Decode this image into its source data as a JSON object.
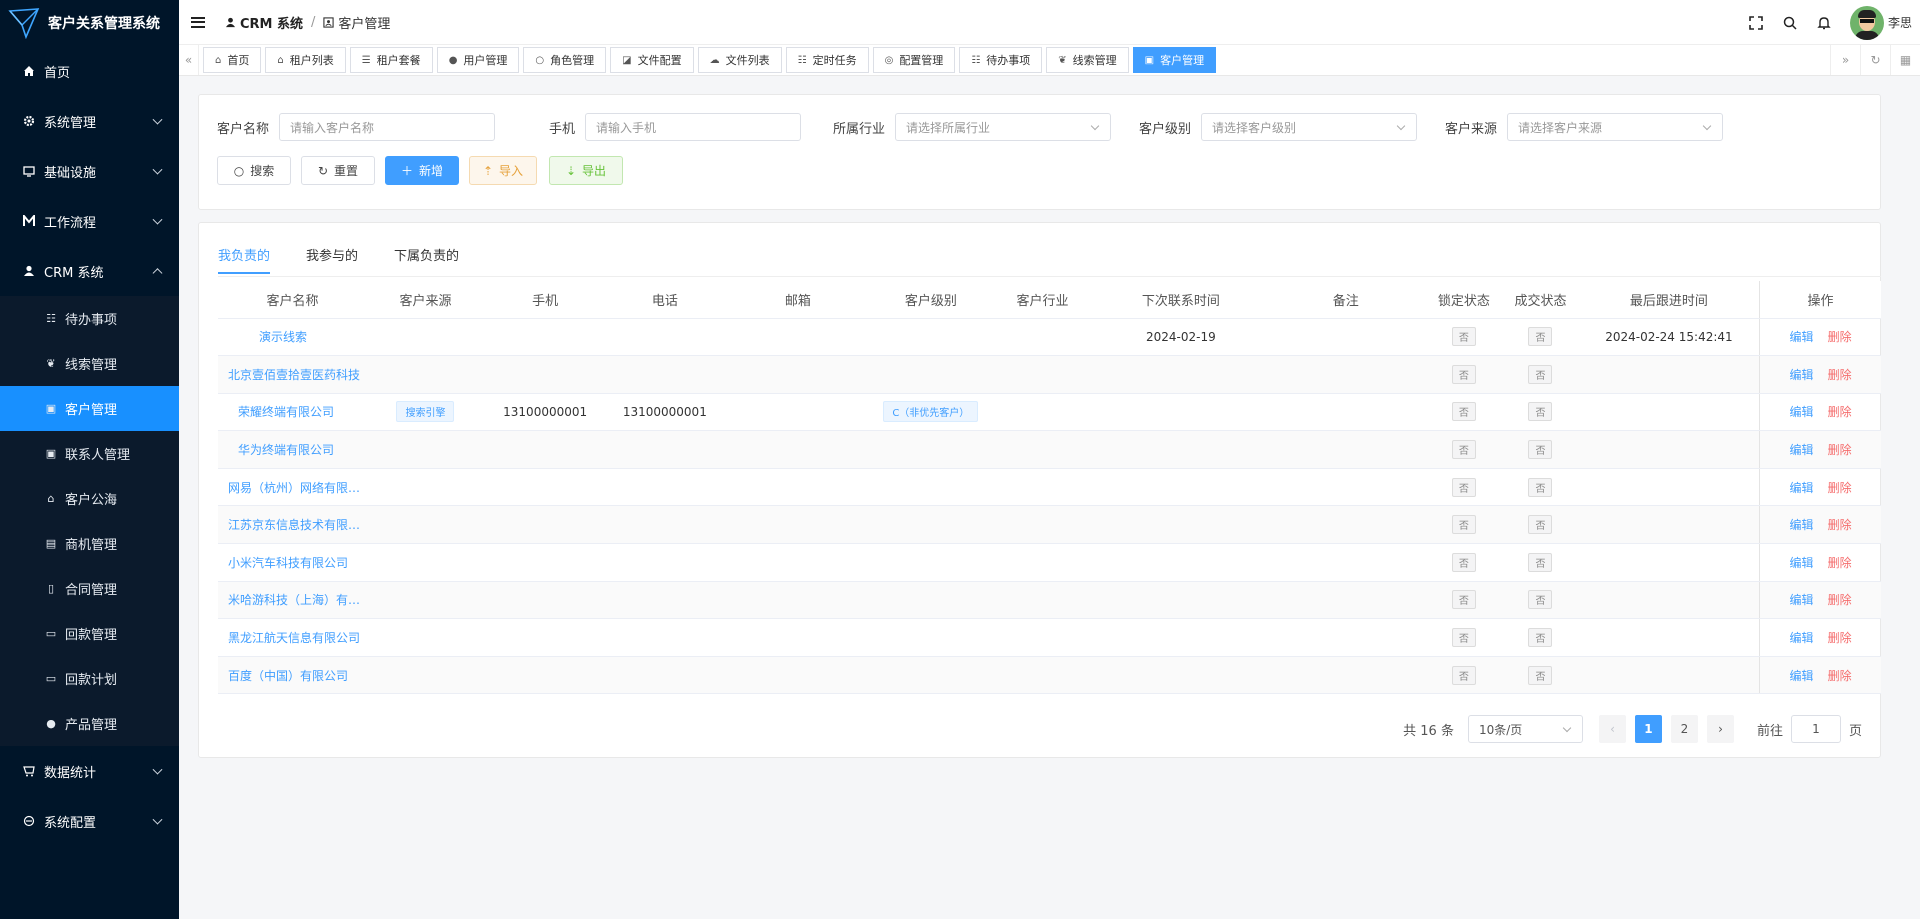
{
  "app": {
    "title": "客户关系管理系统"
  },
  "sidebar": {
    "items": [
      {
        "label": "首页",
        "icon": "home-icon"
      },
      {
        "label": "系统管理",
        "icon": "gear-icon"
      },
      {
        "label": "基础设施",
        "icon": "monitor-icon"
      },
      {
        "label": "工作流程",
        "icon": "flow-icon"
      },
      {
        "label": "CRM 系统",
        "icon": "user-icon"
      }
    ],
    "crm_sub": [
      {
        "label": "待办事项",
        "icon": "list-icon"
      },
      {
        "label": "线索管理",
        "icon": "leaf-icon"
      },
      {
        "label": "客户管理",
        "icon": "contact-icon",
        "active": true
      },
      {
        "label": "联系人管理",
        "icon": "contact-card-icon"
      },
      {
        "label": "客户公海",
        "icon": "pool-icon"
      },
      {
        "label": "商机管理",
        "icon": "bus-icon"
      },
      {
        "label": "合同管理",
        "icon": "file-icon"
      },
      {
        "label": "回款管理",
        "icon": "receipt-icon"
      },
      {
        "label": "回款计划",
        "icon": "money-icon"
      },
      {
        "label": "产品管理",
        "icon": "product-icon"
      }
    ],
    "tail": [
      {
        "label": "数据统计",
        "icon": "chart-icon"
      },
      {
        "label": "系统配置",
        "icon": "config-icon"
      }
    ]
  },
  "header": {
    "breadcrumb": [
      "CRM 系统",
      "客户管理"
    ],
    "user": "李思"
  },
  "tabs": [
    {
      "label": "首页",
      "icon": "home-icon"
    },
    {
      "label": "租户列表",
      "icon": "home-outline-icon"
    },
    {
      "label": "租户套餐",
      "icon": "menu-icon"
    },
    {
      "label": "用户管理",
      "icon": "user-icon"
    },
    {
      "label": "角色管理",
      "icon": "user-outline-icon"
    },
    {
      "label": "文件配置",
      "icon": "file-config-icon"
    },
    {
      "label": "文件列表",
      "icon": "cloud-icon"
    },
    {
      "label": "定时任务",
      "icon": "task-icon"
    },
    {
      "label": "配置管理",
      "icon": "config-icon"
    },
    {
      "label": "待办事项",
      "icon": "list-icon"
    },
    {
      "label": "线索管理",
      "icon": "leaf-icon"
    },
    {
      "label": "客户管理",
      "icon": "contact-icon",
      "active": true
    }
  ],
  "filters": {
    "name": {
      "label": "客户名称",
      "placeholder": "请输入客户名称"
    },
    "mobile": {
      "label": "手机",
      "placeholder": "请输入手机"
    },
    "industry": {
      "label": "所属行业",
      "placeholder": "请选择所属行业"
    },
    "level": {
      "label": "客户级别",
      "placeholder": "请选择客户级别"
    },
    "source": {
      "label": "客户来源",
      "placeholder": "请选择客户来源"
    }
  },
  "buttons": {
    "search": "搜索",
    "reset": "重置",
    "add": "新增",
    "import": "导入",
    "export": "导出"
  },
  "subtabs": [
    "我负责的",
    "我参与的",
    "下属负责的"
  ],
  "table": {
    "columns": [
      "客户名称",
      "客户来源",
      "手机",
      "电话",
      "邮箱",
      "客户级别",
      "客户行业",
      "下次联系时间",
      "备注",
      "锁定状态",
      "成交状态",
      "最后跟进时间",
      "操作"
    ],
    "rows": [
      {
        "name": "演示线索",
        "source": "",
        "mobile": "",
        "phone": "",
        "email": "",
        "level": "",
        "industry": "",
        "next": "2024-02-19",
        "remark": "",
        "locked": "否",
        "deal": "否",
        "last": "2024-02-24 15:42:41"
      },
      {
        "name": "北京壹佰壹拾壹医药科技",
        "source": "",
        "mobile": "",
        "phone": "",
        "email": "",
        "level": "",
        "industry": "",
        "next": "",
        "remark": "",
        "locked": "否",
        "deal": "否",
        "last": ""
      },
      {
        "name": "荣耀终端有限公司",
        "source": "搜索引擎",
        "mobile": "13100000001",
        "phone": "13100000001",
        "email": "",
        "level": "C（非优先客户）",
        "industry": "",
        "next": "",
        "remark": "",
        "locked": "否",
        "deal": "否",
        "last": ""
      },
      {
        "name": "华为终端有限公司",
        "source": "",
        "mobile": "",
        "phone": "",
        "email": "",
        "level": "",
        "industry": "",
        "next": "",
        "remark": "",
        "locked": "否",
        "deal": "否",
        "last": ""
      },
      {
        "name": "网易（杭州）网络有限公司",
        "source": "",
        "mobile": "",
        "phone": "",
        "email": "",
        "level": "",
        "industry": "",
        "next": "",
        "remark": "",
        "locked": "否",
        "deal": "否",
        "last": ""
      },
      {
        "name": "江苏京东信息技术有限公司",
        "source": "",
        "mobile": "",
        "phone": "",
        "email": "",
        "level": "",
        "industry": "",
        "next": "",
        "remark": "",
        "locked": "否",
        "deal": "否",
        "last": ""
      },
      {
        "name": "小米汽车科技有限公司",
        "source": "",
        "mobile": "",
        "phone": "",
        "email": "",
        "level": "",
        "industry": "",
        "next": "",
        "remark": "",
        "locked": "否",
        "deal": "否",
        "last": ""
      },
      {
        "name": "米哈游科技（上海）有限公司",
        "source": "",
        "mobile": "",
        "phone": "",
        "email": "",
        "level": "",
        "industry": "",
        "next": "",
        "remark": "",
        "locked": "否",
        "deal": "否",
        "last": ""
      },
      {
        "name": "黑龙江航天信息有限公司",
        "source": "",
        "mobile": "",
        "phone": "",
        "email": "",
        "level": "",
        "industry": "",
        "next": "",
        "remark": "",
        "locked": "否",
        "deal": "否",
        "last": ""
      },
      {
        "name": "百度（中国）有限公司",
        "source": "",
        "mobile": "",
        "phone": "",
        "email": "",
        "level": "",
        "industry": "",
        "next": "",
        "remark": "",
        "locked": "否",
        "deal": "否",
        "last": ""
      }
    ],
    "edit_label": "编辑",
    "delete_label": "删除"
  },
  "pagination": {
    "total": "共 16 条",
    "page_size": "10条/页",
    "pages": [
      "1",
      "2"
    ],
    "current": "1",
    "goto_label": "前往",
    "goto_value": "1",
    "page_unit": "页"
  },
  "colors": {
    "sidebar_bg": "#001529",
    "primary": "#409eff",
    "danger": "#f56c6c"
  }
}
